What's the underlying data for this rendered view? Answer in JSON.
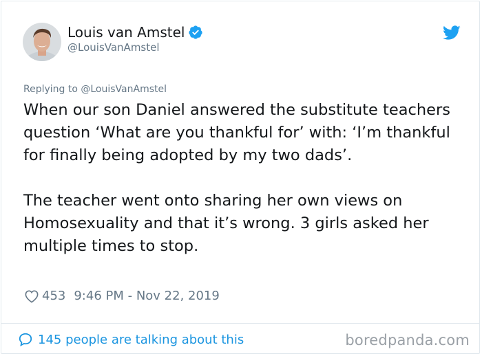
{
  "author": {
    "name": "Louis van Amstel",
    "handle": "@LouisVanAmstel",
    "verified": true
  },
  "tweet": {
    "replying_to": "Replying to @LouisVanAmstel",
    "paragraph_1": "When our son Daniel answered the substitute teachers question ‘What are you thankful for’ with: ‘I’m thankful for finally being adopted by my two dads’.",
    "paragraph_2": "The teacher went onto sharing her own views on Homosexuality and that it’s wrong. 3 girls asked her multiple times to stop.",
    "likes": "453",
    "timestamp": "9:46 PM - Nov 22, 2019"
  },
  "footer": {
    "talking": "145 people are talking about this",
    "watermark": "boredpanda.com"
  },
  "colors": {
    "accent": "#1b95e0",
    "twitter_blue": "#1da1f2",
    "muted": "#657786",
    "text": "#14171a"
  },
  "icons": {
    "verified": "verified-badge-icon",
    "platform": "twitter-bird-icon",
    "like": "heart-icon",
    "reply": "speech-bubble-icon"
  }
}
